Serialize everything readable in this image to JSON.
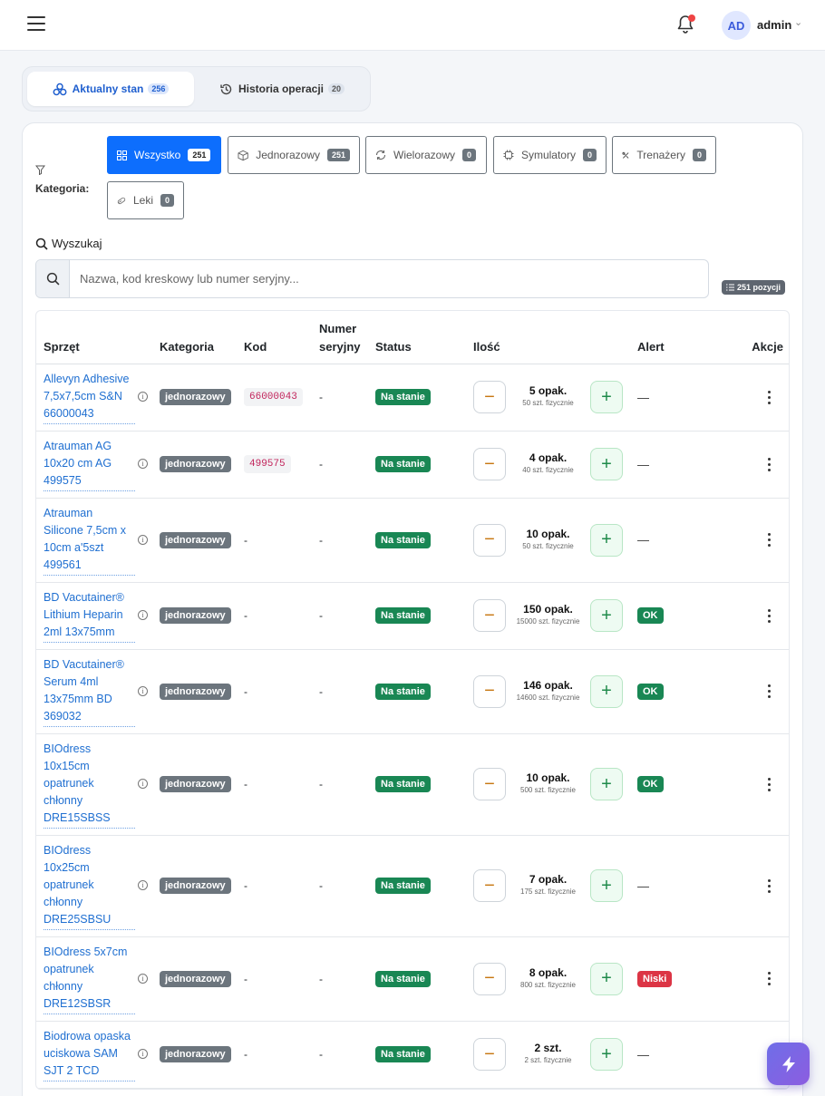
{
  "header": {
    "avatar_initials": "AD",
    "user_name": "admin"
  },
  "tabs": [
    {
      "label": "Aktualny stan",
      "count": "256",
      "active": true
    },
    {
      "label": "Historia operacji",
      "count": "20",
      "active": false
    }
  ],
  "filters": {
    "label": "Kategoria:",
    "chips": [
      {
        "label": "Wszystko",
        "count": "251",
        "icon": "grid-icon",
        "active": true
      },
      {
        "label": "Jednorazowy",
        "count": "251",
        "icon": "box-icon",
        "active": false
      },
      {
        "label": "Wielorazowy",
        "count": "0",
        "icon": "recycle-icon",
        "active": false
      },
      {
        "label": "Symulatory",
        "count": "0",
        "icon": "chip-icon",
        "active": false
      },
      {
        "label": "Trenażery",
        "count": "0",
        "icon": "tools-icon",
        "active": false
      },
      {
        "label": "Leki",
        "count": "0",
        "icon": "capsule-icon",
        "active": false
      }
    ]
  },
  "search": {
    "label": "Wyszukaj",
    "placeholder": "Nazwa, kod kreskowy lub numer seryjny...",
    "count_label": "251 pozycji"
  },
  "table": {
    "headers": {
      "name": "Sprzęt",
      "category": "Kategoria",
      "code": "Kod",
      "serial": "Numer seryjny",
      "status": "Status",
      "qty": "Ilość",
      "alert": "Alert",
      "actions": "Akcje"
    },
    "rows": [
      {
        "name": "Allevyn Adhesive 7,5x7,5cm S&N 66000043",
        "category": "jednorazowy",
        "code": "66000043",
        "serial": "-",
        "status": "Na stanie",
        "qty_main": "5 opak.",
        "qty_sub": "50 szt. fizycznie",
        "alert": "—",
        "alert_type": "none"
      },
      {
        "name": "Atrauman AG 10x20 cm AG 499575",
        "category": "jednorazowy",
        "code": "499575",
        "serial": "-",
        "status": "Na stanie",
        "qty_main": "4 opak.",
        "qty_sub": "40 szt. fizycznie",
        "alert": "—",
        "alert_type": "none"
      },
      {
        "name": "Atrauman Silicone 7,5cm x 10cm a'5szt 499561",
        "category": "jednorazowy",
        "code": "-",
        "serial": "-",
        "status": "Na stanie",
        "qty_main": "10 opak.",
        "qty_sub": "50 szt. fizycznie",
        "alert": "—",
        "alert_type": "none"
      },
      {
        "name": "BD Vacutainer® Lithium Heparin 2ml 13x75mm",
        "category": "jednorazowy",
        "code": "-",
        "serial": "-",
        "status": "Na stanie",
        "qty_main": "150 opak.",
        "qty_sub": "15000 szt. fizycznie",
        "alert": "OK",
        "alert_type": "ok"
      },
      {
        "name": "BD Vacutainer® Serum 4ml 13x75mm BD 369032",
        "category": "jednorazowy",
        "code": "-",
        "serial": "-",
        "status": "Na stanie",
        "qty_main": "146 opak.",
        "qty_sub": "14600 szt. fizycznie",
        "alert": "OK",
        "alert_type": "ok"
      },
      {
        "name": "BIOdress 10x15cm opatrunek chłonny DRE15SBSS",
        "category": "jednorazowy",
        "code": "-",
        "serial": "-",
        "status": "Na stanie",
        "qty_main": "10 opak.",
        "qty_sub": "500 szt. fizycznie",
        "alert": "OK",
        "alert_type": "ok"
      },
      {
        "name": "BIOdress 10x25cm opatrunek chłonny DRE25SBSU",
        "category": "jednorazowy",
        "code": "-",
        "serial": "-",
        "status": "Na stanie",
        "qty_main": "7 opak.",
        "qty_sub": "175 szt. fizycznie",
        "alert": "—",
        "alert_type": "none"
      },
      {
        "name": "BIOdress 5x7cm opatrunek chłonny DRE12SBSR",
        "category": "jednorazowy",
        "code": "-",
        "serial": "-",
        "status": "Na stanie",
        "qty_main": "8 opak.",
        "qty_sub": "800 szt. fizycznie",
        "alert": "Niski",
        "alert_type": "low"
      },
      {
        "name": "Biodrowa opaska uciskowa SAM SJT 2 TCD",
        "category": "jednorazowy",
        "code": "-",
        "serial": "-",
        "status": "Na stanie",
        "qty_main": "2 szt.",
        "qty_sub": "2 szt. fizycznie",
        "alert": "—",
        "alert_type": "none"
      }
    ]
  },
  "colors": {
    "primary": "#0d6efd",
    "link": "#1f6fd1",
    "success": "#198754",
    "danger": "#dc3545",
    "secondary": "#6c757d"
  }
}
